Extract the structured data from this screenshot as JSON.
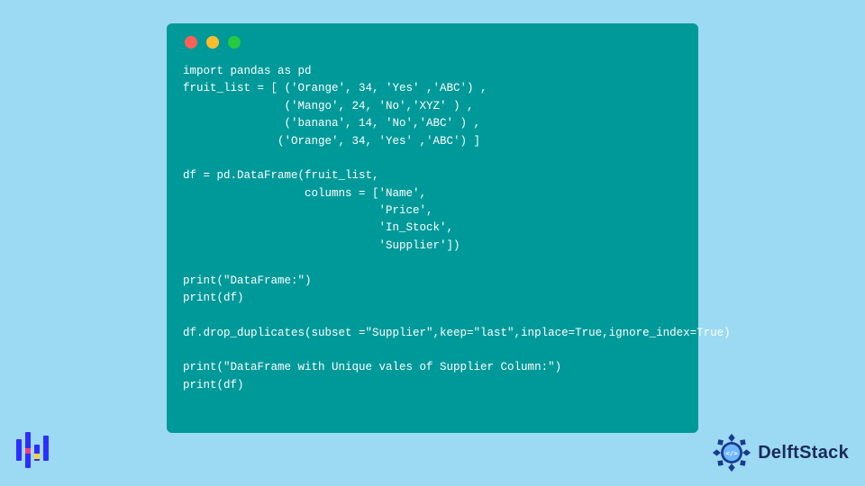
{
  "code": {
    "lines": [
      "import pandas as pd",
      "fruit_list = [ ('Orange', 34, 'Yes' ,'ABC') ,",
      "               ('Mango', 24, 'No','XYZ' ) ,",
      "               ('banana', 14, 'No','ABC' ) ,",
      "              ('Orange', 34, 'Yes' ,'ABC') ]",
      "",
      "df = pd.DataFrame(fruit_list,",
      "                  columns = ['Name',",
      "                             'Price',",
      "                             'In_Stock',",
      "                             'Supplier'])",
      "",
      "print(\"DataFrame:\")",
      "print(df)",
      "",
      "df.drop_duplicates(subset =\"Supplier\",keep=\"last\",inplace=True,ignore_index=True)",
      "",
      "print(\"DataFrame with Unique vales of Supplier Column:\")",
      "print(df)"
    ]
  },
  "brand": {
    "name": "DelftStack"
  },
  "colors": {
    "background": "#9bdaf2",
    "window": "#009999",
    "brand_text": "#1b2a5b",
    "gear": "#1b3b8f"
  }
}
